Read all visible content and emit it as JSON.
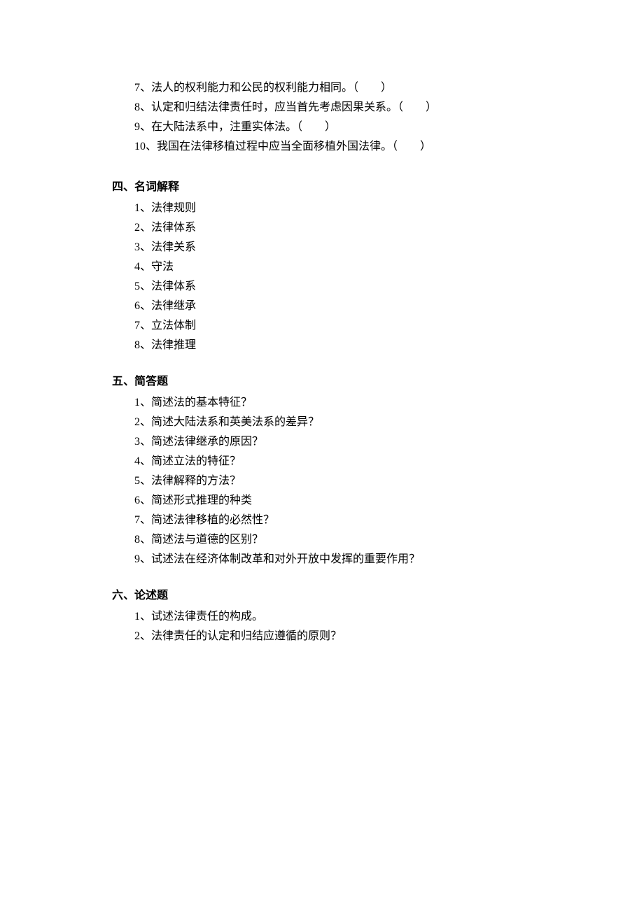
{
  "tf": {
    "items": [
      "7、法人的权利能力和公民的权利能力相同。（        ）",
      "8、认定和归结法律责任时，应当首先考虑因果关系。（        ）",
      "9、在大陆法系中，注重实体法。（        ）",
      "10、我国在法律移植过程中应当全面移植外国法律。（        ）"
    ]
  },
  "sec4": {
    "heading": "四、名词解释",
    "items": [
      "1、法律规则",
      "2、法律体系",
      "3、法律关系",
      "4、守法",
      "5、法律体系",
      "6、法律继承",
      "7、立法体制",
      "8、法律推理"
    ]
  },
  "sec5": {
    "heading": "五、简答题",
    "items": [
      "1、简述法的基本特征？",
      "2、简述大陆法系和英美法系的差异？",
      "3、简述法律继承的原因？",
      "4、简述立法的特征？",
      "5、法律解释的方法？",
      "6、简述形式推理的种类",
      "7、简述法律移植的必然性？",
      "8、简述法与道德的区别？",
      "9、试述法在经济体制改革和对外开放中发挥的重要作用？"
    ]
  },
  "sec6": {
    "heading": "六、论述题",
    "items": [
      "1、试述法律责任的构成。",
      "2、法律责任的认定和归结应遵循的原则？"
    ]
  }
}
